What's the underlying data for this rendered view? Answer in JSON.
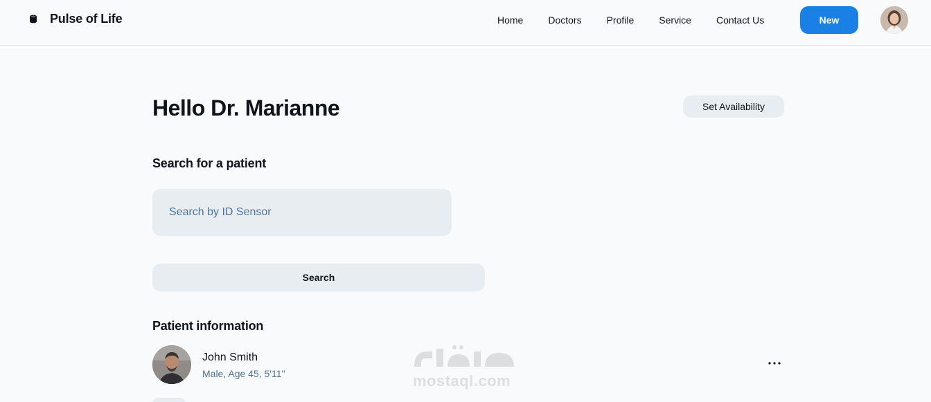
{
  "header": {
    "brand": "Pulse of Life",
    "nav": [
      "Home",
      "Doctors",
      "Profile",
      "Service",
      "Contact Us"
    ],
    "new_button": "New",
    "avatar_icon": "doctor-avatar"
  },
  "main": {
    "greeting": "Hello Dr. Marianne",
    "availability_button": "Set Availability",
    "search": {
      "title": "Search for a patient",
      "placeholder": "Search by ID Sensor",
      "value": "",
      "button": "Search"
    },
    "patient_info": {
      "title": "Patient information",
      "patient": {
        "name": "John Smith",
        "details": "Male, Age 45, 5'11''"
      },
      "more_icon": "ellipsis"
    }
  },
  "watermark": {
    "text": "mostaql.com"
  },
  "colors": {
    "accent": "#1a80e5",
    "background": "#f8fafc",
    "input_bg": "#e8edf2",
    "muted_text": "#4f7396",
    "text": "#0f141a"
  }
}
